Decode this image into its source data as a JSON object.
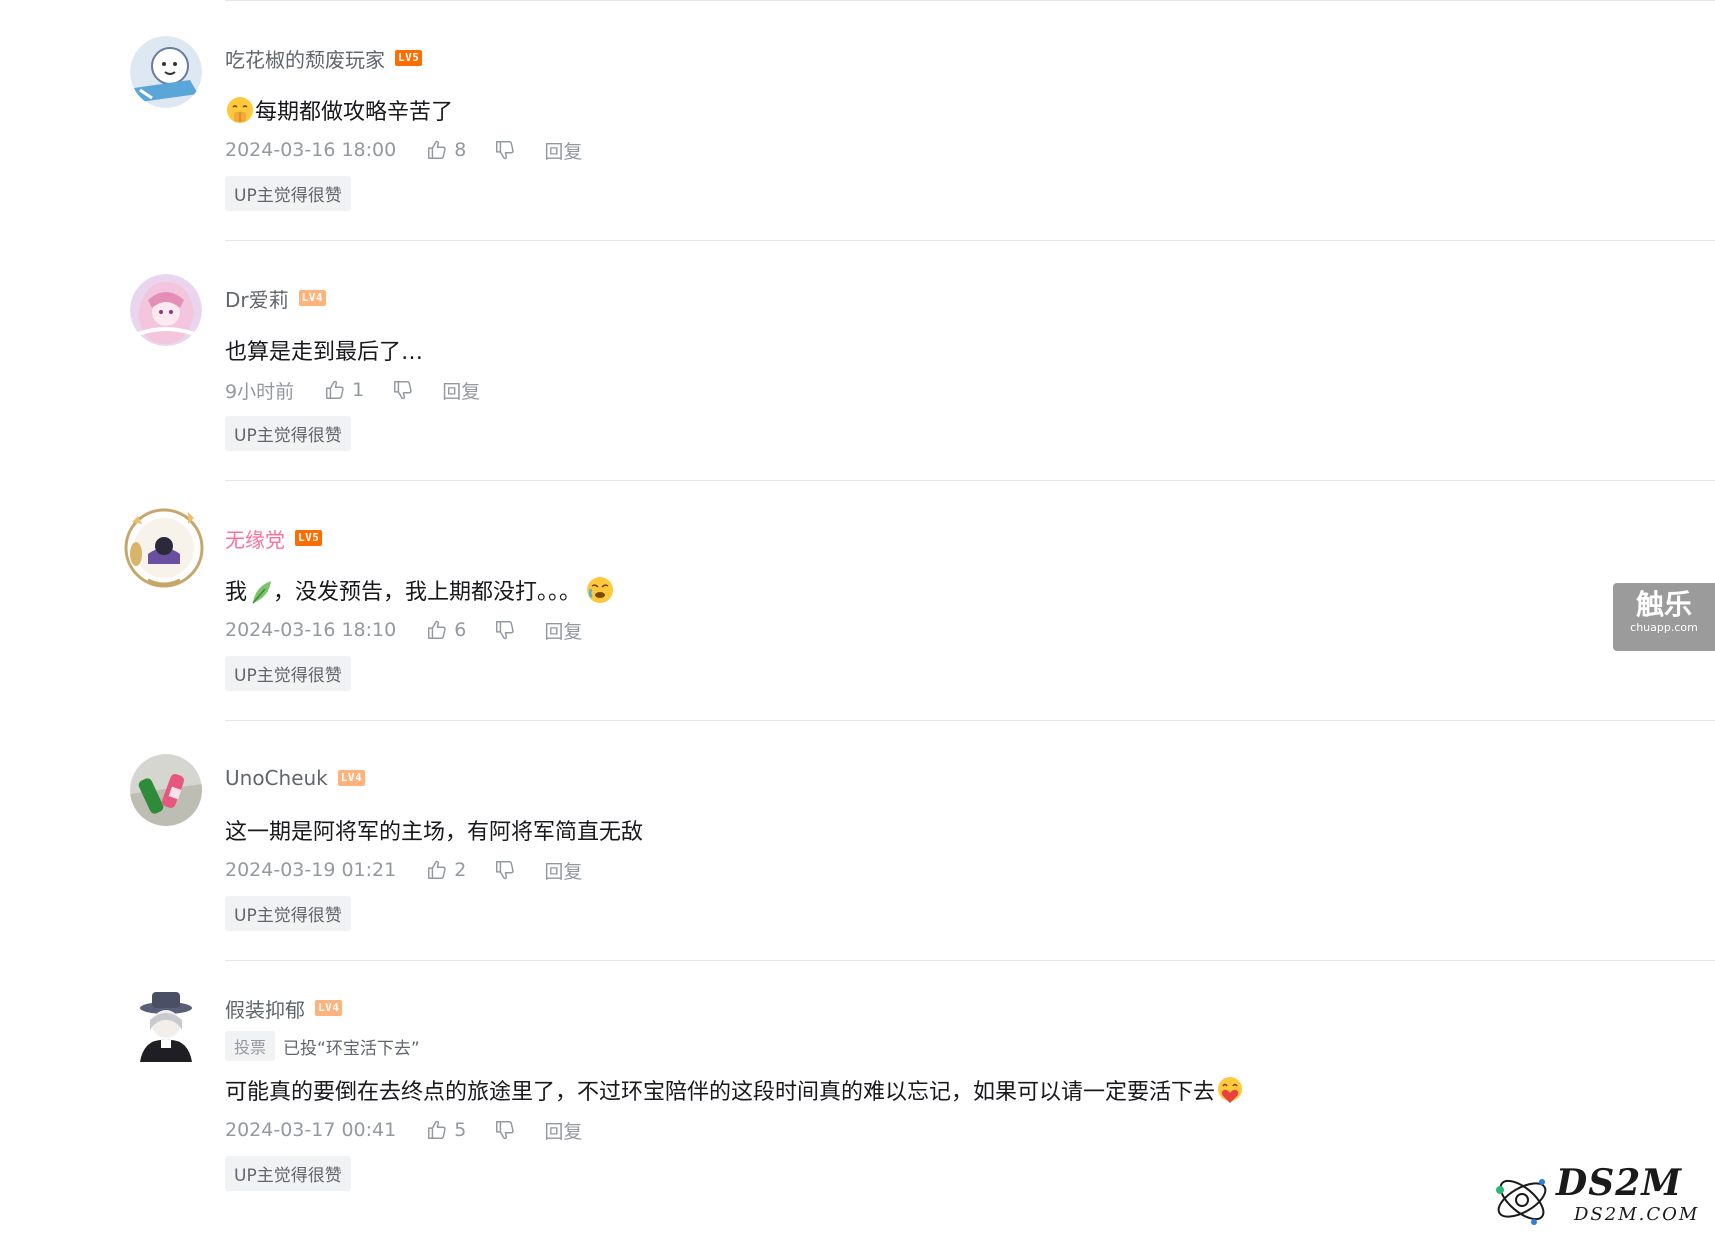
{
  "comments": [
    {
      "username": "吃花椒的颓废玩家",
      "level": "LV5",
      "text": "每期都做攻略辛苦了",
      "time": "2024-03-16 18:00",
      "likes": "8",
      "reply": "回复",
      "tag": "UP主觉得很赞"
    },
    {
      "username": "Dr爱莉",
      "level": "LV4",
      "text": "也算是走到最后了…",
      "time": "9小时前",
      "likes": "1",
      "reply": "回复",
      "tag": "UP主觉得很赞"
    },
    {
      "username": "无缘党",
      "level": "LV5",
      "text_before": "我",
      "text": "，没发预告，我上期都没打。。。",
      "time": "2024-03-16 18:10",
      "likes": "6",
      "reply": "回复",
      "tag": "UP主觉得很赞"
    },
    {
      "username": "UnoCheuk",
      "level": "LV4",
      "text": "这一期是阿将军的主场，有阿将军简直无敌",
      "time": "2024-03-19 01:21",
      "likes": "2",
      "reply": "回复",
      "tag": "UP主觉得很赞"
    },
    {
      "username": "假装抑郁",
      "level": "LV4",
      "vote_tag": "投票",
      "vote_text": "已投“环宝活下去”",
      "text": "可能真的要倒在去终点的旅途里了，不过环宝陪伴的这段时间真的难以忘记，如果可以请一定要活下去",
      "time": "2024-03-17 00:41",
      "likes": "5",
      "reply": "回复",
      "tag": "UP主觉得很赞"
    }
  ],
  "watermarks": {
    "side_big": "触乐",
    "side_small": "chuapp.com",
    "ds2m_big": "DS2M",
    "ds2m_small": "DS2M.COM"
  },
  "colors": {
    "vip_name": "#fb7299",
    "lv5": "#ff6c00",
    "lv4": "#ffb37c"
  }
}
